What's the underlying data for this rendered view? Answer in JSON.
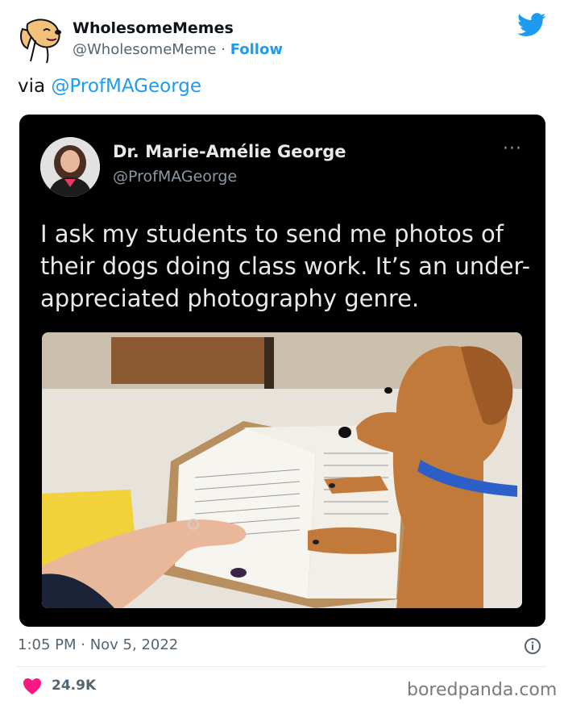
{
  "author": {
    "name": "WholesomeMemes",
    "handle": "@WholesomeMeme",
    "separator": " · ",
    "follow_label": "Follow"
  },
  "intro": {
    "prefix": "via ",
    "mention": "@ProfMAGeorge"
  },
  "quoted_tweet": {
    "name": "Dr. Marie-Amélie George",
    "handle": "@ProfMAGeorge",
    "more_label": "···",
    "text": "I ask my students to send me photos of their dogs doing class work. It’s an under-appreciated photography genre."
  },
  "meta": {
    "timestamp": "1:05 PM · Nov 5, 2022"
  },
  "engagement": {
    "likes": "24.9K"
  },
  "watermark": "boredpanda.com",
  "icons": {
    "avatar": "dog-avatar-icon",
    "brand": "twitter-bird-icon",
    "info": "info-icon",
    "like": "heart-icon"
  },
  "colors": {
    "accent": "#1d9bf0",
    "heart": "#f91880",
    "muted": "#536471"
  }
}
